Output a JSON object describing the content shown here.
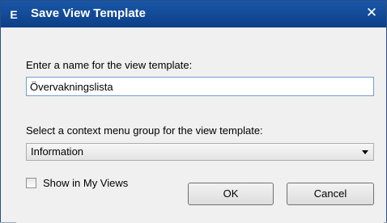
{
  "window": {
    "icon": "E",
    "icon_name": "app-icon",
    "title": "Save View Template",
    "close_glyph": "✕"
  },
  "form": {
    "name_label": "Enter a name for the view template:",
    "name_value": "Övervakningslista",
    "group_label": "Select a context menu group for the view template:",
    "group_selected": "Information",
    "show_in_views_label": "Show in My Views",
    "show_in_views_checked": false
  },
  "buttons": {
    "ok_label": "OK",
    "cancel_label": "Cancel"
  },
  "colors": {
    "titlebar": "#0c3f86",
    "input_border": "#7a9cd3",
    "dialog_bg": "#f0f0f0"
  }
}
